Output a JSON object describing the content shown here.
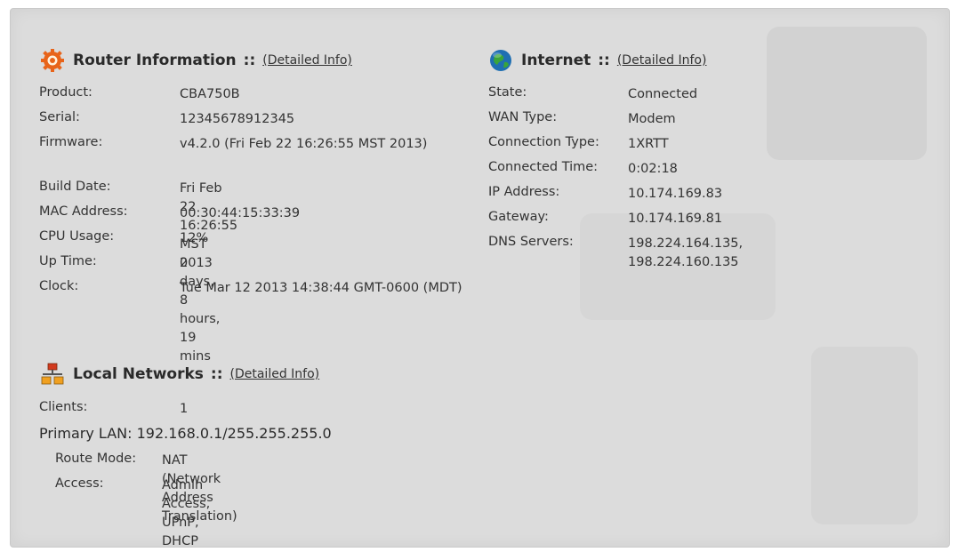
{
  "router": {
    "title": "Router Information",
    "separator": "::",
    "link": "(Detailed Info)",
    "rows": [
      {
        "label": "Product:",
        "value": "CBA750B"
      },
      {
        "label": "Serial:",
        "value": "12345678912345"
      },
      {
        "label": "Firmware:",
        "value": "v4.2.0 (Fri Feb 22 16:26:55 MST 2013)"
      },
      {
        "label": "Build Date:",
        "value": "Fri Feb 22 16:26:55 MST 2013"
      },
      {
        "label": "MAC Address:",
        "value": "00:30:44:15:33:39"
      },
      {
        "label": "CPU Usage:",
        "value": "12%"
      },
      {
        "label": "Up Time:",
        "value": "0 days, 8 hours, 19 mins"
      },
      {
        "label": "Clock:",
        "value": "Tue Mar 12 2013 14:38:44 GMT-0600 (MDT)"
      }
    ]
  },
  "internet": {
    "title": "Internet",
    "separator": "::",
    "link": "(Detailed Info)",
    "rows": [
      {
        "label": "State:",
        "value": "Connected"
      },
      {
        "label": "WAN Type:",
        "value": "Modem"
      },
      {
        "label": "Connection Type:",
        "value": "1XRTT"
      },
      {
        "label": "Connected Time:",
        "value": "0:02:18"
      },
      {
        "label": "IP Address:",
        "value": "10.174.169.83"
      },
      {
        "label": "Gateway:",
        "value": "10.174.169.81"
      },
      {
        "label": "DNS Servers:",
        "value": "198.224.164.135, 198.224.160.135"
      }
    ]
  },
  "local": {
    "title": "Local Networks",
    "separator": "::",
    "link": "(Detailed Info)",
    "clients_label": "Clients:",
    "clients_value": "1",
    "primary_lan": "Primary LAN: 192.168.0.1/255.255.255.0",
    "route_mode_label": "Route Mode:",
    "route_mode_value": "NAT (Network Address Translation)",
    "access_label": "Access:",
    "access_value": "Admin Access, UPnP, DHCP"
  },
  "icons": {
    "router": "router-gear-icon",
    "internet": "globe-icon",
    "local": "network-icon"
  },
  "colors": {
    "panel_bg": "#dcdcdc",
    "router_icon": "#e8641a",
    "globe_blue": "#1f6fb2",
    "globe_green": "#3aa53a",
    "network_red": "#d23a1e",
    "network_orange": "#f0a020"
  }
}
